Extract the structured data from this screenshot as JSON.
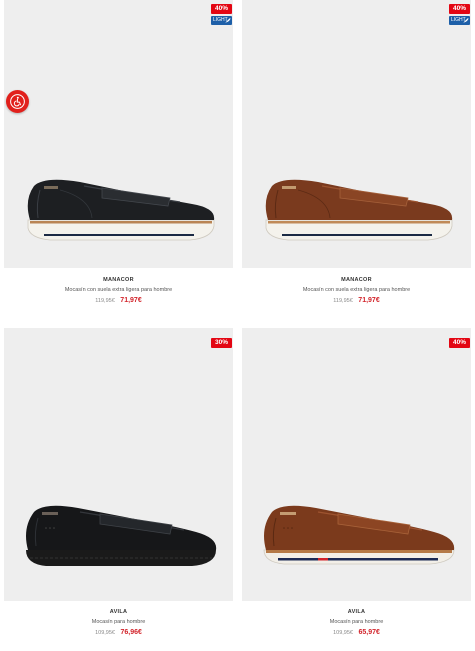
{
  "products": [
    {
      "name": "MANACOR",
      "description": "Mocasín con suela extra ligera para hombre",
      "old_price": "119,95€",
      "new_price": "71,97€",
      "discount": "40%",
      "tag": "LIGHT",
      "color": "black"
    },
    {
      "name": "MANACOR",
      "description": "Mocasín con suela extra ligera para hombre",
      "old_price": "119,95€",
      "new_price": "71,97€",
      "discount": "40%",
      "tag": "LIGHT",
      "color": "brown"
    },
    {
      "name": "AVILA",
      "description": "Mocasín para hombre",
      "old_price": "109,95€",
      "new_price": "76,96€",
      "discount": "30%",
      "color": "black"
    },
    {
      "name": "AVILA",
      "description": "Mocasín para hombre",
      "old_price": "109,95€",
      "new_price": "65,97€",
      "discount": "40%",
      "color": "brown"
    }
  ],
  "accessibility_button": {
    "icon": "wheelchair-icon",
    "color": "#e1201c"
  },
  "colors": {
    "badge": "#e30613",
    "light_tag": "#1d5fa8",
    "sale_price": "#d2232a",
    "card_bg": "#eeeeee"
  }
}
